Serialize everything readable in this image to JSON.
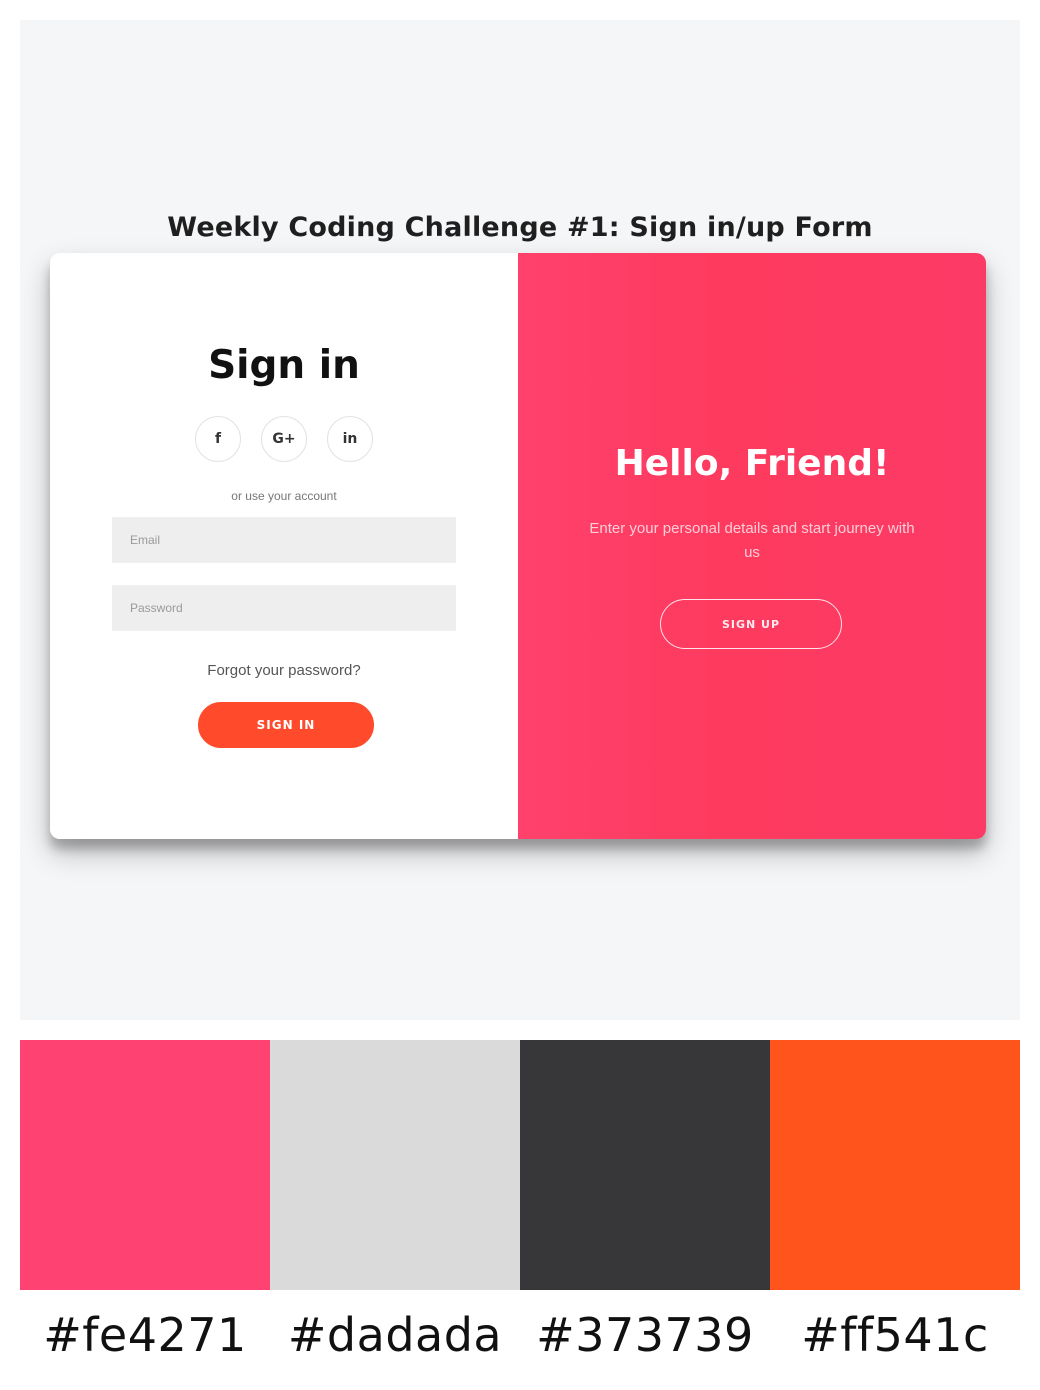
{
  "page": {
    "heading": "Weekly Coding Challenge #1: Sign in/up Form"
  },
  "signin": {
    "title": "Sign in",
    "social": [
      {
        "icon": "facebook-icon",
        "glyph": "f"
      },
      {
        "icon": "google-plus-icon",
        "glyph": "G+"
      },
      {
        "icon": "linkedin-icon",
        "glyph": "in"
      }
    ],
    "hint": "or use your account",
    "email_placeholder": "Email",
    "password_placeholder": "Password",
    "forgot": "Forgot your password?",
    "button": "SIGN IN",
    "button_color": "#ff4b2b"
  },
  "overlay": {
    "title": "Hello, Friend!",
    "text": "Enter your personal details and start journey with us",
    "button": "SIGN UP",
    "background_color": "#ff416c"
  },
  "palette": [
    {
      "hex": "#fe4271",
      "label": "#fe4271"
    },
    {
      "hex": "#dadada",
      "label": "#dadada"
    },
    {
      "hex": "#373739",
      "label": "#373739"
    },
    {
      "hex": "#ff541c",
      "label": "#ff541c"
    }
  ]
}
